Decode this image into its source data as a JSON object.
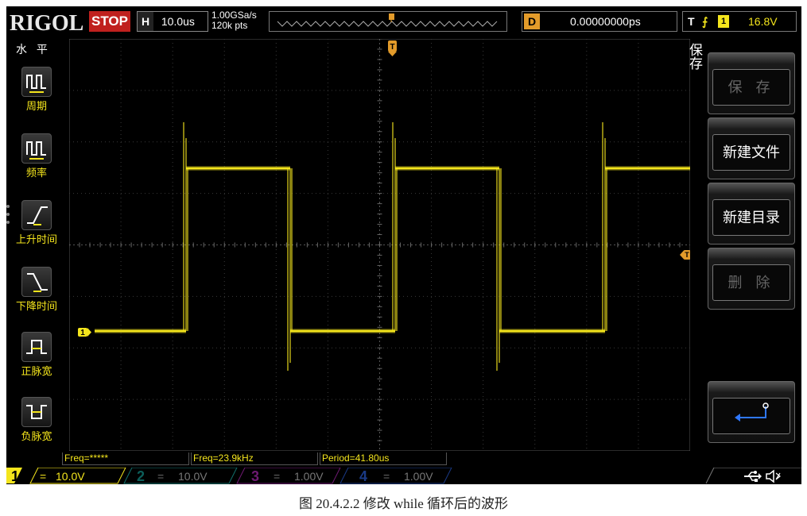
{
  "brand": "RIGOL",
  "run_state": "STOP",
  "horizontal": {
    "key": "H",
    "timebase": "10.0us"
  },
  "acquisition": {
    "sample_rate": "1.00GSa/s",
    "memory_depth": "120k pts"
  },
  "delay": {
    "key": "D",
    "value": "0.00000000ps"
  },
  "trigger": {
    "key": "T",
    "edge_symbol": "⨍",
    "source": "1",
    "level": "16.8V"
  },
  "left_menu": {
    "title": "水 平",
    "items": [
      {
        "label": "周期",
        "icon": "period-icon"
      },
      {
        "label": "频率",
        "icon": "frequency-icon"
      },
      {
        "label": "上升时间",
        "icon": "rise-time-icon"
      },
      {
        "label": "下降时间",
        "icon": "fall-time-icon"
      },
      {
        "label": "正脉宽",
        "icon": "positive-width-icon"
      },
      {
        "label": "负脉宽",
        "icon": "negative-width-icon"
      }
    ]
  },
  "right_menu": {
    "title": "保存",
    "buttons": [
      {
        "label": "保 存",
        "enabled": false
      },
      {
        "label": "新建文件",
        "enabled": true
      },
      {
        "label": "新建目录",
        "enabled": true
      },
      {
        "label": "删 除",
        "enabled": false
      },
      {
        "label": "",
        "enabled": true,
        "icon": "return-icon"
      }
    ]
  },
  "measurements": [
    "Freq=*****",
    "Freq=23.9kHz",
    "Period=41.80us"
  ],
  "channels": [
    {
      "num": "1",
      "coupling": "=",
      "scale": "10.0V",
      "active": true,
      "color": "#f4e51c"
    },
    {
      "num": "2",
      "coupling": "=",
      "scale": "10.0V",
      "active": false,
      "color": "#1fc7c0"
    },
    {
      "num": "3",
      "coupling": "=",
      "scale": "1.00V",
      "active": false,
      "color": "#c02ec7"
    },
    {
      "num": "4",
      "coupling": "=",
      "scale": "1.00V",
      "active": false,
      "color": "#2b5bd8"
    }
  ],
  "markers": {
    "channel": "1",
    "trigger_level": "T",
    "trigger_position": "T"
  },
  "waveform_color": "#f4e51c",
  "caption": "图 20.4.2.2  修改 while 循环后的波形"
}
